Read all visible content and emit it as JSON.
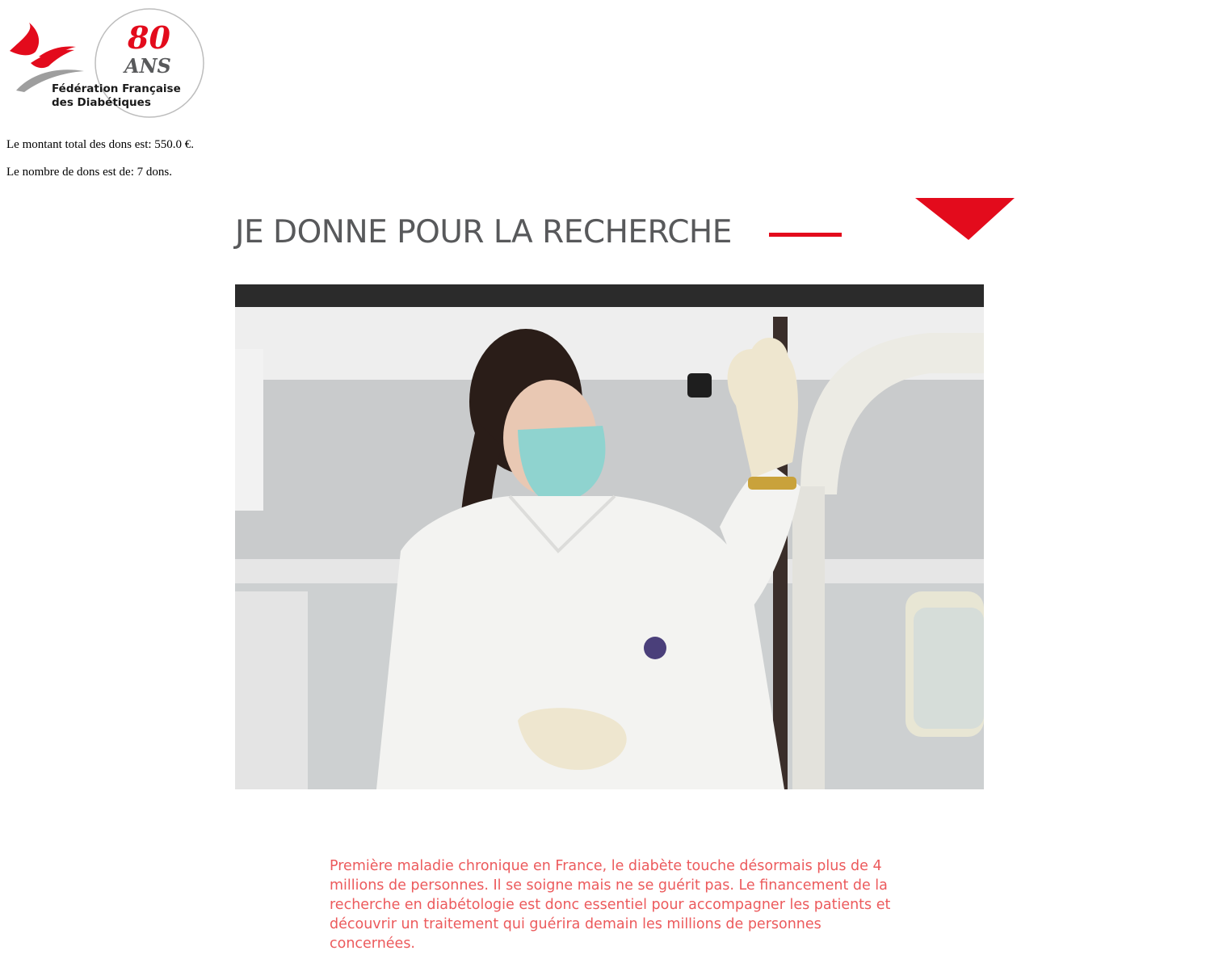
{
  "header": {
    "logo": {
      "anniversary_number": "80",
      "anniversary_word": "ANS",
      "org_name_line1": "Fédération Française",
      "org_name_line2": "des Diabétiques"
    }
  },
  "stats": {
    "total_text": "Le montant total des dons est: 550.0 €.",
    "count_text": "Le nombre de dons est de: 7 dons."
  },
  "section": {
    "title": "JE DONNE POUR LA RECHERCHE",
    "intro": "Première maladie chronique en France, le diabète touche désormais plus de 4 millions de personnes. Il se soigne mais ne se guérit pas. Le financement de la recherche en diabétologie est donc essentiel pour accompagner les patients et découvrir un traitement qui guérira demain les millions de personnes concernées."
  },
  "colors": {
    "brand_red": "#e30b1c",
    "title_gray": "#58595b",
    "intro_text": "#ec5a5c"
  },
  "icons": {
    "logo": "ffd-bird-logo",
    "dropdown": "chevron-down-icon"
  }
}
